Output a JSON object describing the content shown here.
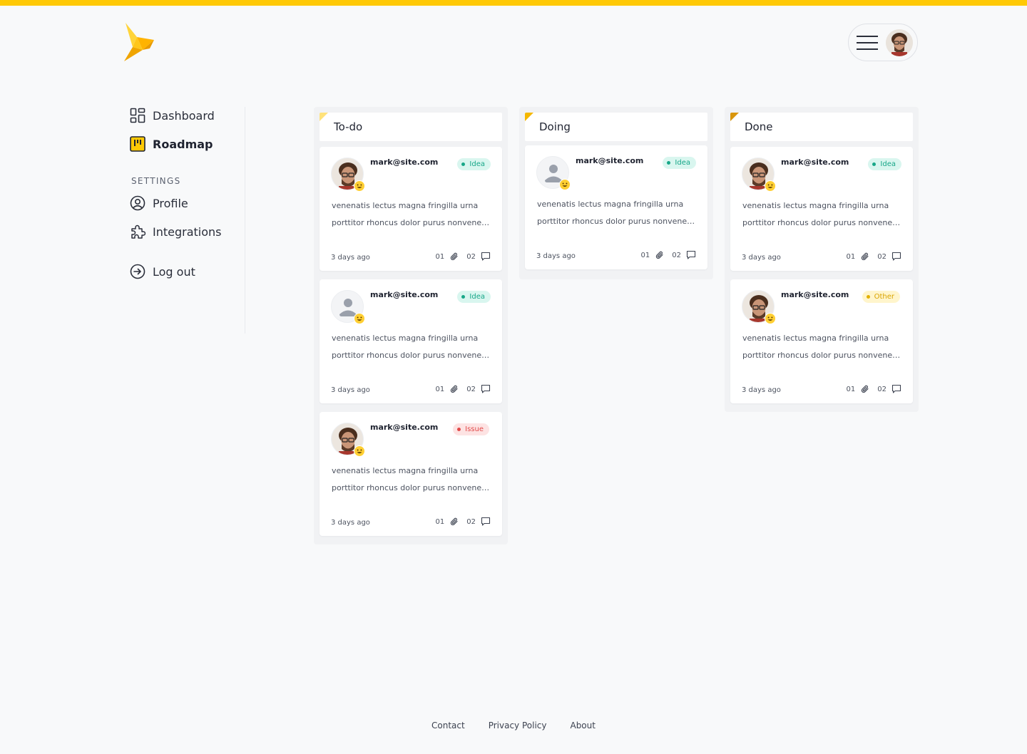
{
  "brand": {
    "accent": "#ffc905",
    "logo": "bird-logo"
  },
  "header": {
    "menu_icon": "hamburger-icon",
    "avatar": "user-avatar"
  },
  "sidebar": {
    "items": [
      {
        "label": "Dashboard",
        "icon": "grid-icon"
      },
      {
        "label": "Roadmap",
        "icon": "roadmap-icon",
        "active": true
      }
    ],
    "settings_label": "SETTINGS",
    "settings_items": [
      {
        "label": "Profile",
        "icon": "user-circle-icon"
      },
      {
        "label": "Integrations",
        "icon": "puzzle-icon"
      }
    ],
    "logout": {
      "label": "Log out",
      "icon": "logout-icon"
    }
  },
  "board": {
    "columns": [
      {
        "title": "To-do",
        "corner_color": "#ffe27a",
        "cards": [
          {
            "email": "mark@site.com",
            "tag": "Idea",
            "tag_type": "idea",
            "avatar": "photo",
            "line1": "venenatis lectus magna fringilla urna",
            "line2": "porttitor rhoncus dolor purus nonvenenatis",
            "time": "3 days ago",
            "attachments": "01",
            "comments": "02"
          },
          {
            "email": "mark@site.com",
            "tag": "Idea",
            "tag_type": "idea",
            "avatar": "placeholder",
            "line1": "venenatis lectus magna fringilla urna",
            "line2": "porttitor rhoncus dolor purus nonvenenatis",
            "time": "3 days ago",
            "attachments": "01",
            "comments": "02"
          },
          {
            "email": "mark@site.com",
            "tag": "Issue",
            "tag_type": "issue",
            "avatar": "photo",
            "line1": "venenatis lectus magna fringilla urna",
            "line2": "porttitor rhoncus dolor purus nonvenenatis",
            "time": "3 days ago",
            "attachments": "01",
            "comments": "02"
          }
        ]
      },
      {
        "title": "Doing",
        "corner_color": "#f5b800",
        "cards": [
          {
            "email": "mark@site.com",
            "tag": "Idea",
            "tag_type": "idea",
            "avatar": "placeholder",
            "line1": "venenatis lectus magna fringilla urna",
            "line2": "porttitor rhoncus dolor purus nonvenenatis",
            "time": "3 days ago",
            "attachments": "01",
            "comments": "02"
          }
        ]
      },
      {
        "title": "Done",
        "corner_color": "#d9960c",
        "cards": [
          {
            "email": "mark@site.com",
            "tag": "Idea",
            "tag_type": "idea",
            "avatar": "photo",
            "line1": "venenatis lectus magna fringilla urna",
            "line2": "porttitor rhoncus dolor purus nonvenenatis",
            "time": "3 days ago",
            "attachments": "01",
            "comments": "02"
          },
          {
            "email": "mark@site.com",
            "tag": "Other",
            "tag_type": "other",
            "avatar": "photo",
            "line1": "venenatis lectus magna fringilla urna",
            "line2": "porttitor rhoncus dolor purus nonvenenatis",
            "time": "3 days ago",
            "attachments": "01",
            "comments": "02"
          }
        ]
      }
    ]
  },
  "footer": {
    "links": [
      "Contact",
      "Privacy Policy",
      "About"
    ]
  }
}
